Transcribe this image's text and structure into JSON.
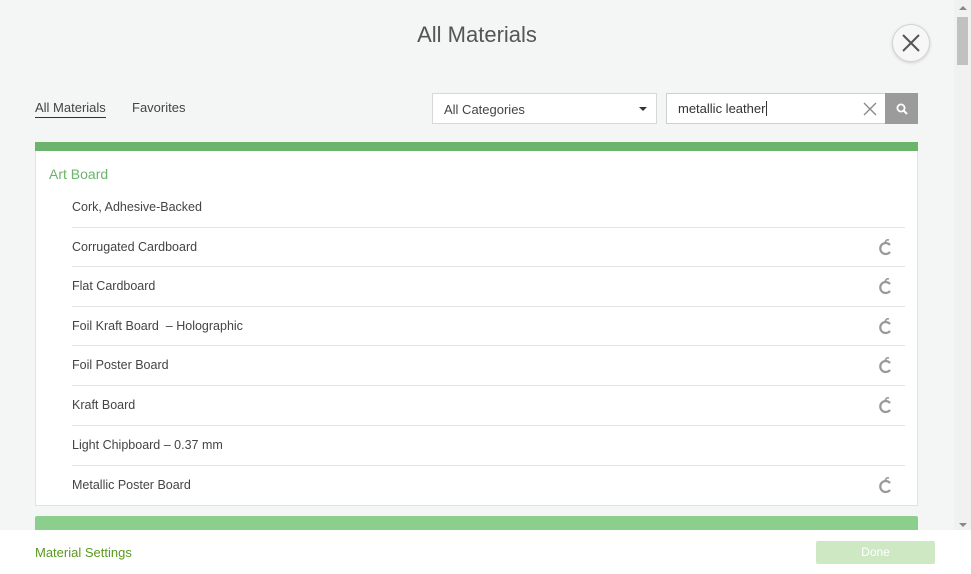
{
  "header": {
    "title": "All Materials"
  },
  "tabs": [
    {
      "label": "All Materials",
      "active": true
    },
    {
      "label": "Favorites",
      "active": false
    }
  ],
  "filters": {
    "category_selected": "All Categories",
    "search_value": "metallic leather"
  },
  "category": {
    "heading": "Art Board",
    "color": "#6cb46c",
    "items": [
      {
        "label": "Cork, Adhesive-Backed",
        "icon": null
      },
      {
        "label": "Corrugated Cardboard",
        "icon": "cricut-logo-icon"
      },
      {
        "label": "Flat Cardboard",
        "icon": "cricut-logo-icon"
      },
      {
        "label": "Foil Kraft Board  – Holographic",
        "icon": "cricut-logo-icon"
      },
      {
        "label": "Foil Poster Board",
        "icon": "cricut-logo-icon"
      },
      {
        "label": "Kraft Board",
        "icon": "cricut-logo-icon"
      },
      {
        "label": "Light Chipboard – 0.37 mm",
        "icon": null
      },
      {
        "label": "Metallic Poster Board",
        "icon": "cricut-logo-icon"
      }
    ]
  },
  "footer": {
    "settings_link": "Material Settings",
    "done_label": "Done"
  },
  "colors": {
    "accent": "#6cb46c",
    "link": "#5a9a1f",
    "done_disabled": "#cde8c2"
  }
}
